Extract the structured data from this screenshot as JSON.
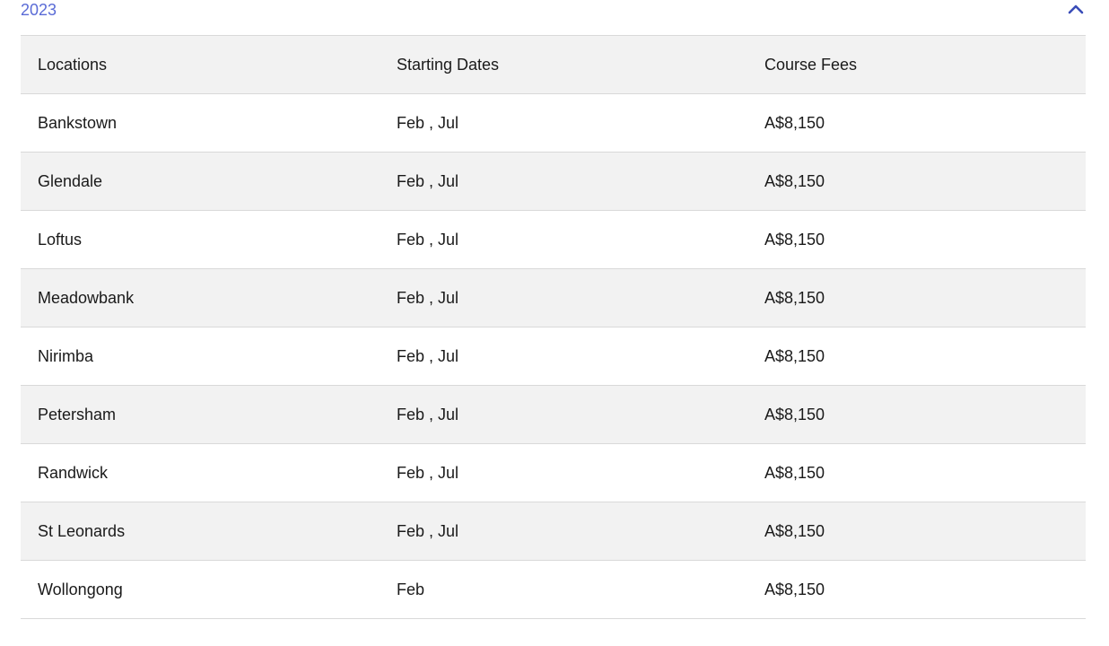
{
  "section": {
    "year": "2023",
    "chevron_icon": "chevron-up-icon",
    "accent_color": "#5a6bd6"
  },
  "table": {
    "headers": [
      "Locations",
      "Starting Dates",
      "Course Fees"
    ],
    "rows": [
      [
        "Bankstown",
        "Feb , Jul",
        "A$8,150"
      ],
      [
        "Glendale",
        "Feb , Jul",
        "A$8,150"
      ],
      [
        "Loftus",
        "Feb , Jul",
        "A$8,150"
      ],
      [
        "Meadowbank",
        "Feb , Jul",
        "A$8,150"
      ],
      [
        "Nirimba",
        "Feb , Jul",
        "A$8,150"
      ],
      [
        "Petersham",
        "Feb , Jul",
        "A$8,150"
      ],
      [
        "Randwick",
        "Feb , Jul",
        "A$8,150"
      ],
      [
        "St Leonards",
        "Feb , Jul",
        "A$8,150"
      ],
      [
        "Wollongong",
        "Feb",
        "A$8,150"
      ]
    ]
  }
}
